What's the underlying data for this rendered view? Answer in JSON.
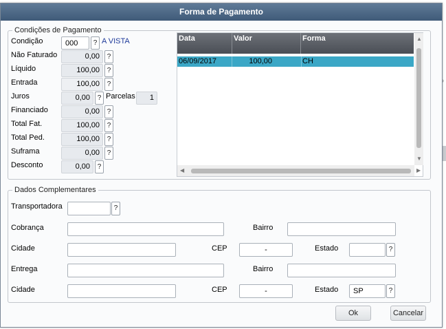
{
  "window": {
    "title": "Forma de Pagamento"
  },
  "condicoes": {
    "legend": "Condições de Pagamento",
    "condicao": {
      "label": "Condição",
      "value": "000",
      "help": "?",
      "description": "A VISTA"
    },
    "nao_faturado": {
      "label": "Não Faturado",
      "value": "0,00",
      "help": "?"
    },
    "liquido": {
      "label": "Líquido",
      "value": "100,00",
      "help": "?"
    },
    "entrada": {
      "label": "Entrada",
      "value": "100,00",
      "help": "?"
    },
    "juros": {
      "label": "Juros",
      "value": "0,00",
      "help": "?"
    },
    "parcelas": {
      "label": "Parcelas",
      "value": "1"
    },
    "financiado": {
      "label": "Financiado",
      "value": "0,00",
      "help": "?"
    },
    "total_fat": {
      "label": "Total Fat.",
      "value": "100,00",
      "help": "?"
    },
    "total_ped": {
      "label": "Total Ped.",
      "value": "100,00",
      "help": "?"
    },
    "suframa": {
      "label": "Suframa",
      "value": "0,00",
      "help": "?"
    },
    "desconto": {
      "label": "Desconto",
      "value": "0,00",
      "help": "?"
    }
  },
  "grid": {
    "columns": [
      "Data",
      "Valor",
      "Forma"
    ],
    "rows": [
      {
        "data": "06/09/2017",
        "valor": "100,00",
        "forma": "CH"
      }
    ],
    "selected_row_color": "#3ba7c6"
  },
  "complementares": {
    "legend": "Dados Complementares",
    "transportadora": {
      "label": "Transportadora",
      "value": "",
      "help": "?"
    },
    "cobranca": {
      "label": "Cobrança",
      "value": ""
    },
    "bairro1": {
      "label": "Bairro",
      "value": ""
    },
    "cidade1": {
      "label": "Cidade",
      "value": ""
    },
    "cep1": {
      "label": "CEP",
      "value": "-"
    },
    "estado1": {
      "label": "Estado",
      "value": "",
      "help": "?"
    },
    "entrega": {
      "label": "Entrega",
      "value": ""
    },
    "bairro2": {
      "label": "Bairro",
      "value": ""
    },
    "cidade2": {
      "label": "Cidade",
      "value": ""
    },
    "cep2": {
      "label": "CEP",
      "value": "-"
    },
    "estado2": {
      "label": "Estado",
      "value": "SP",
      "help": "?"
    }
  },
  "buttons": {
    "ok": "Ok",
    "cancel": "Cancelar"
  },
  "colors": {
    "title_bar": "#4f6a88",
    "grid_header": "#5b5f66",
    "accent_link": "#1e3a9a"
  },
  "icons": {
    "background_glyph": "magnifier-icon"
  }
}
